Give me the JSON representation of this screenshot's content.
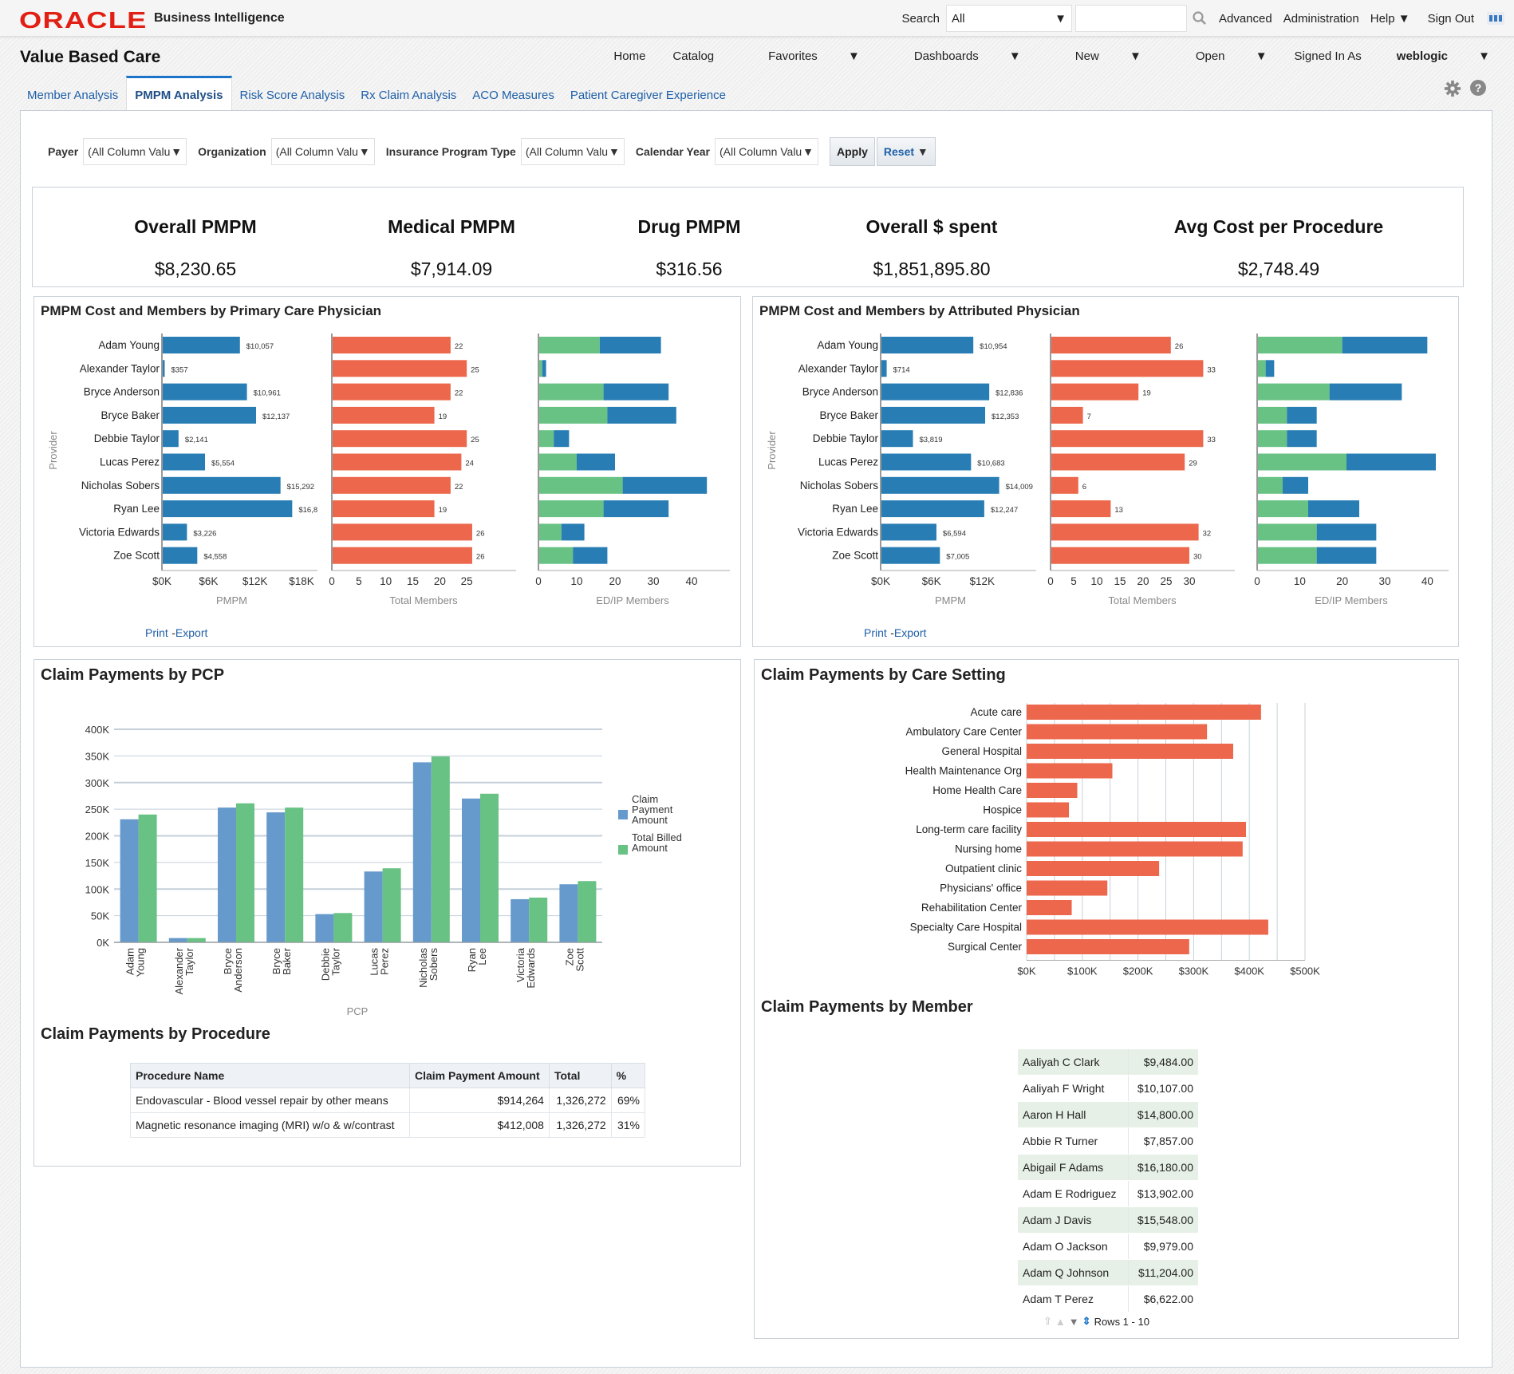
{
  "header": {
    "brand": "ORACLE",
    "product": "Business Intelligence",
    "search_label": "Search",
    "search_scope": "All",
    "search_value": "",
    "links": [
      "Advanced",
      "Administration",
      "Help",
      "Sign Out"
    ]
  },
  "app": {
    "title": "Value Based Care",
    "nav": [
      "Home",
      "Catalog",
      "Favorites",
      "Dashboards",
      "New",
      "Open"
    ],
    "signed_in_label": "Signed In As",
    "user": "weblogic"
  },
  "tabs": [
    {
      "label": "Member Analysis",
      "active": false
    },
    {
      "label": "PMPM Analysis",
      "active": true
    },
    {
      "label": "Risk Score Analysis",
      "active": false
    },
    {
      "label": "Rx Claim Analysis",
      "active": false
    },
    {
      "label": "ACO Measures",
      "active": false
    },
    {
      "label": "Patient Caregiver Experience",
      "active": false
    }
  ],
  "prompts": [
    {
      "label": "Payer",
      "value": "(All Column Valu"
    },
    {
      "label": "Organization",
      "value": "(All Column Valu"
    },
    {
      "label": "Insurance Program Type",
      "value": "(All Column Valu"
    },
    {
      "label": "Calendar Year",
      "value": "(All Column Valu"
    }
  ],
  "buttons": {
    "apply": "Apply",
    "reset": "Reset"
  },
  "kpis": [
    {
      "title": "Overall PMPM",
      "value": "$8,230.65"
    },
    {
      "title": "Medical PMPM",
      "value": "$7,914.09"
    },
    {
      "title": "Drug PMPM",
      "value": "$316.56"
    },
    {
      "title": "Overall $ spent",
      "value": "$1,851,895.80"
    },
    {
      "title": "Avg Cost per Procedure",
      "value": "$2,748.49"
    }
  ],
  "links": {
    "print": "Print",
    "sep": "-",
    "export": "Export"
  },
  "colors": {
    "blue": "#277db4",
    "orange": "#ec674b",
    "green": "#68c284",
    "bar_blue_light": "#6699cc"
  },
  "chart_data": [
    {
      "id": "pcp",
      "type": "bar",
      "title": "PMPM Cost and Members by Primary Care Physician",
      "ylabel": "Provider",
      "categories": [
        "Adam Young",
        "Alexander Taylor",
        "Bryce Anderson",
        "Bryce Baker",
        "Debbie Taylor",
        "Lucas Perez",
        "Nicholas Sobers",
        "Ryan Lee",
        "Victoria Edwards",
        "Zoe Scott"
      ],
      "pmpm": {
        "xlabel": "PMPM",
        "values": [
          10057,
          357,
          10961,
          12137,
          2141,
          5554,
          15292,
          16800,
          3226,
          4558
        ],
        "labels": [
          "$10,057",
          "$357",
          "$10,961",
          "$12,137",
          "$2,141",
          "$5,554",
          "$15,292",
          "$16,8",
          "$3,226",
          "$4,558"
        ],
        "ticks": [
          "$0K",
          "$6K",
          "$12K",
          "$18K"
        ],
        "xlim": [
          0,
          18000
        ]
      },
      "members": {
        "xlabel": "Total Members",
        "values": [
          22,
          25,
          22,
          19,
          25,
          24,
          22,
          19,
          26,
          26
        ],
        "ticks": [
          "0",
          "5",
          "10",
          "15",
          "20",
          "25"
        ],
        "xlim": [
          0,
          30
        ]
      },
      "edip": {
        "xlabel": "ED/IP Members",
        "ed": [
          16,
          1,
          17,
          18,
          4,
          10,
          22,
          17,
          6,
          9
        ],
        "ip": [
          16,
          1,
          17,
          18,
          4,
          10,
          22,
          17,
          6,
          9
        ],
        "ticks": [
          "0",
          "10",
          "20",
          "30",
          "40"
        ],
        "xlim": [
          0,
          50
        ]
      }
    },
    {
      "id": "attr",
      "type": "bar",
      "title": "PMPM Cost and Members by Attributed Physician",
      "ylabel": "Provider",
      "categories": [
        "Adam Young",
        "Alexander Taylor",
        "Bryce Anderson",
        "Bryce Baker",
        "Debbie Taylor",
        "Lucas Perez",
        "Nicholas Sobers",
        "Ryan Lee",
        "Victoria Edwards",
        "Zoe Scott"
      ],
      "pmpm": {
        "xlabel": "PMPM",
        "values": [
          10954,
          714,
          12836,
          12353,
          3819,
          10683,
          14009,
          12247,
          6594,
          7005
        ],
        "labels": [
          "$10,954",
          "$714",
          "$12,836",
          "$12,353",
          "$3,819",
          "$10,683",
          "$14,009",
          "$12,247",
          "$6,594",
          "$7,005"
        ],
        "ticks": [
          "$0K",
          "$6K",
          "$12K"
        ],
        "xlim": [
          0,
          16500
        ]
      },
      "members": {
        "xlabel": "Total Members",
        "values": [
          26,
          33,
          19,
          7,
          33,
          29,
          6,
          13,
          32,
          30
        ],
        "ticks": [
          "0",
          "5",
          "10",
          "15",
          "20",
          "25",
          "30"
        ],
        "xlim": [
          0,
          35
        ]
      },
      "edip": {
        "xlabel": "ED/IP Members",
        "ed": [
          20,
          2,
          17,
          7,
          7,
          21,
          6,
          12,
          14,
          14
        ],
        "ip": [
          20,
          2,
          17,
          7,
          7,
          21,
          6,
          12,
          14,
          14
        ],
        "ticks": [
          "0",
          "10",
          "20",
          "30",
          "40"
        ],
        "xlim": [
          0,
          45
        ]
      }
    },
    {
      "id": "claims_pcp",
      "type": "bar",
      "title": "Claim Payments by PCP",
      "xlabel": "PCP",
      "categories": [
        "Adam Young",
        "Alexander Taylor",
        "Bryce Anderson",
        "Bryce Baker",
        "Debbie Taylor",
        "Lucas Perez",
        "Nicholas Sobers",
        "Ryan Lee",
        "Victoria Edwards",
        "Zoe Scott"
      ],
      "series": [
        {
          "name": "Claim Payment Amount",
          "values": [
            231000,
            8000,
            253000,
            244000,
            53000,
            133000,
            338000,
            270000,
            81000,
            109000
          ]
        },
        {
          "name": "Total Billed Amount",
          "values": [
            240000,
            8000,
            261000,
            253000,
            55000,
            139000,
            349000,
            279000,
            84000,
            115000
          ]
        }
      ],
      "yticks": [
        "0K",
        "50K",
        "100K",
        "150K",
        "200K",
        "250K",
        "300K",
        "350K",
        "400K"
      ],
      "ylim": [
        0,
        400000
      ],
      "legend": "right",
      "grid": true
    },
    {
      "id": "care_setting",
      "type": "bar",
      "title": "Claim Payments by Care Setting",
      "categories": [
        "Acute care",
        "Ambulatory Care Center",
        "General Hospital",
        "Health Maintenance Org",
        "Home Health Care",
        "Hospice",
        "Long-term care facility",
        "Nursing home",
        "Outpatient clinic",
        "Physicians' office",
        "Rehabilitation Center",
        "Specialty Care Hospital",
        "Surgical Center"
      ],
      "values": [
        421000,
        324000,
        371000,
        154000,
        91000,
        76000,
        394000,
        388000,
        238000,
        145000,
        81000,
        434000,
        292000
      ],
      "xticks": [
        "$0K",
        "$100K",
        "$200K",
        "$300K",
        "$400K",
        "$500K"
      ],
      "xlim": [
        0,
        500000
      ],
      "grid": true
    }
  ],
  "procedure_table": {
    "title": "Claim Payments by Procedure",
    "columns": [
      "Procedure Name",
      "Claim Payment Amount",
      "Total",
      "%"
    ],
    "rows": [
      [
        "Endovascular - Blood vessel repair by other means",
        "$914,264",
        "1,326,272",
        "69%"
      ],
      [
        "Magnetic resonance imaging (MRI) w/o & w/contrast",
        "$412,008",
        "1,326,272",
        "31%"
      ]
    ]
  },
  "member_table": {
    "title": "Claim Payments by Member",
    "rows": [
      [
        "Aaliyah C Clark",
        "$9,484.00"
      ],
      [
        "Aaliyah F Wright",
        "$10,107.00"
      ],
      [
        "Aaron H Hall",
        "$14,800.00"
      ],
      [
        "Abbie R Turner",
        "$7,857.00"
      ],
      [
        "Abigail F Adams",
        "$16,180.00"
      ],
      [
        "Adam E Rodriguez",
        "$13,902.00"
      ],
      [
        "Adam J Davis",
        "$15,548.00"
      ],
      [
        "Adam O Jackson",
        "$9,979.00"
      ],
      [
        "Adam Q Johnson",
        "$11,204.00"
      ],
      [
        "Adam T Perez",
        "$6,622.00"
      ]
    ],
    "pager": "Rows 1 - 10"
  }
}
